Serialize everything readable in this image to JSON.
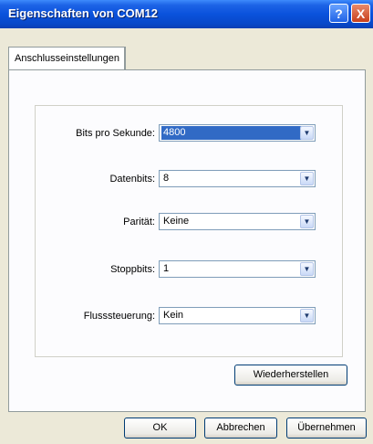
{
  "window": {
    "title": "Eigenschaften von COM12"
  },
  "titlebar": {
    "help_glyph": "?",
    "close_glyph": "X"
  },
  "tabs": [
    {
      "label": "Anschlusseinstellungen"
    }
  ],
  "fields": [
    {
      "label": "Bits pro Sekunde:",
      "value": "4800"
    },
    {
      "label": "Datenbits:",
      "value": "8"
    },
    {
      "label": "Parität:",
      "value": "Keine"
    },
    {
      "label": "Stoppbits:",
      "value": "1"
    },
    {
      "label": "Flusssteuerung:",
      "value": "Kein"
    }
  ],
  "buttons": {
    "restore": "Wiederherstellen",
    "ok": "OK",
    "cancel": "Abbrechen",
    "apply": "Übernehmen"
  },
  "icons": {
    "dropdown": "chevron-down-icon"
  },
  "colors": {
    "titlebar": "#0a52dc",
    "selection": "#316ac5",
    "dialog_bg": "#ece9d8"
  }
}
